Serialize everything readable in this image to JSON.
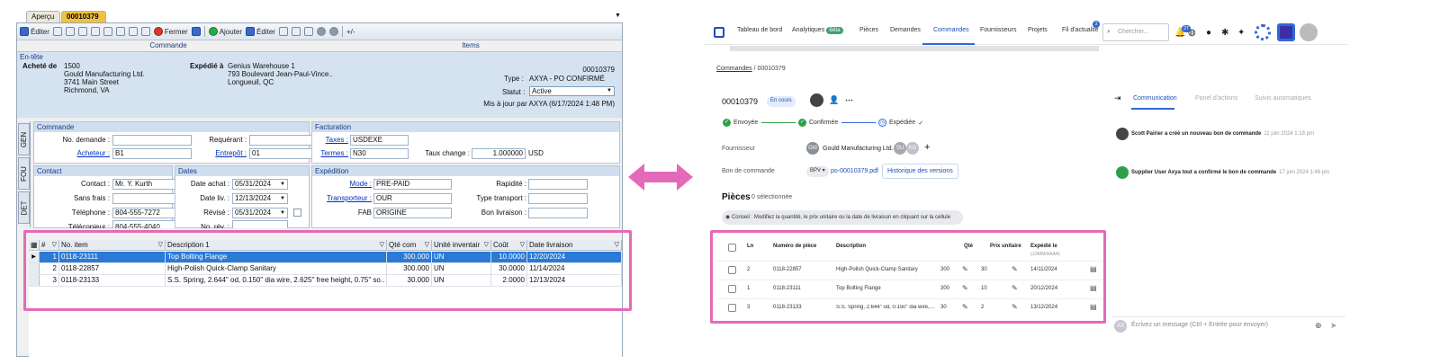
{
  "erp": {
    "tabs": [
      "Aperçu",
      "00010379"
    ],
    "toolbar": {
      "edit": "Éditer",
      "close": "Fermer",
      "add": "Ajouter",
      "edit2": "Éditer",
      "group_order": "Commande",
      "group_items": "Items"
    },
    "header": {
      "section": "En-tête",
      "bought_by_label": "Acheté de",
      "bought_by": [
        "1500",
        "Gould Manufacturing Ltd.",
        "3741 Main Street",
        "Richmond, VA"
      ],
      "shipped_to_label": "Expédié à",
      "shipped_to": [
        "Genius Warehouse 1",
        "793 Boulevard Jean-Paul-Vince..",
        "Longueuil, QC"
      ],
      "po_number": "00010379",
      "type_label": "Type :",
      "type": "AXYA - PO CONFIRMÉ",
      "status_label": "Statut :",
      "status": "Active",
      "updated": "Mis à jour par AXYA (6/17/2024 1:48 PM)"
    },
    "vtabs": [
      "GEN",
      "FOU",
      "DET"
    ],
    "commande": {
      "title": "Commande",
      "no_demande_label": "No. demande :",
      "no_demande": "",
      "requerant_label": "Requérant :",
      "requerant": "",
      "acheteur_label": "Acheteur :",
      "acheteur": "B1",
      "entrepot_label": "Entrepôt :",
      "entrepot": "01"
    },
    "facturation": {
      "title": "Facturation",
      "taxes_label": "Taxes :",
      "taxes": "USDEXE",
      "termes_label": "Termes :",
      "termes": "N30",
      "taux_label": "Taux change :",
      "taux": "1.000000",
      "currency": "USD"
    },
    "contact": {
      "title": "Contact",
      "contact_label": "Contact :",
      "contact": "Mr. Y. Kurth",
      "sans_frais_label": "Sans frais :",
      "sans_frais": "",
      "telephone_label": "Téléphone :",
      "telephone": "804-555-7272",
      "telecopieur_label": "Télécopieur :",
      "telecopieur": "804-555-4040"
    },
    "dates": {
      "title": "Dates",
      "achat_label": "Date achat :",
      "achat": "05/31/2024",
      "liv_label": "Date liv. :",
      "liv": "12/13/2024",
      "revise_label": "Révisé :",
      "revise": "05/31/2024",
      "no_rev_label": "No. rév. :",
      "no_rev": ""
    },
    "expedition": {
      "title": "Expédition",
      "mode_label": "Mode :",
      "mode": "PRE-PAID",
      "transporteur_label": "Transporteur :",
      "transporteur": "OUR",
      "fab_label": "FAB",
      "fab": "ORIGINE",
      "rapidite_label": "Rapidité :",
      "rapidite": "",
      "type_transport_label": "Type transport :",
      "type_transport": "",
      "bon_livraison_label": "Bon livraison :",
      "bon_livraison": ""
    },
    "grid": {
      "columns": [
        "#",
        "No. item",
        "Description 1",
        "Qté com",
        "Unité inventair",
        "Coût",
        "Date livraison"
      ],
      "rows": [
        [
          "1",
          "0118-23111",
          "Top Bolting Flange",
          "300.000",
          "UN",
          "10.0000",
          "12/20/2024"
        ],
        [
          "2",
          "0118-22857",
          "High-Polish Quick-Clamp Sanitary",
          "300.000",
          "UN",
          "30.0000",
          "11/14/2024"
        ],
        [
          "3",
          "0118-23133",
          "S.S. Spring, 2.644\" od, 0.150\" dia wire, 2.625\" free height, 0.75\" so..",
          "30.000",
          "UN",
          "2.0000",
          "12/13/2024"
        ]
      ]
    }
  },
  "web": {
    "nav": [
      "Tableau de bord",
      "Analytiques",
      "Pièces",
      "Demandes",
      "Commandes",
      "Fournisseurs",
      "Projets",
      "Fil d'actualité"
    ],
    "nav_badge": "Bêta",
    "feed_count": "3",
    "notif_count": "27",
    "search_placeholder": "Chercher...",
    "breadcrumb_root": "Commandes",
    "breadcrumb_sep": "/",
    "breadcrumb_current": "00010379",
    "po_number": "00010379",
    "po_status": "En cours",
    "steps": [
      "Envoyée",
      "Confirmée",
      "Expédiée"
    ],
    "supplier_label": "Fournisseur",
    "supplier_initials": "GM",
    "supplier_name": "Gould Manufacturing Ltd.",
    "supplier_avatars": [
      "SU",
      "KG"
    ],
    "po_doc_label": "Bon de commande",
    "po_doc_version": "BPV",
    "po_doc_file": "po-00010379.pdf",
    "version_history": "Historique des versions",
    "pieces_title": "Pièces",
    "pieces_sub": "0 sélectionnée",
    "tip": "Conseil : Modifiez la quantité, le prix unitaire ou la date de livraison en cliquant sur la cellule",
    "table": {
      "headers": [
        "Ln",
        "Numéro de pièce",
        "Description",
        "Qté",
        "Prix unitaire",
        "Expédié le"
      ],
      "date_hint": "(JJ/MM/AAAA)",
      "rows": [
        [
          "2",
          "0118-22857",
          "High-Polish Quick-Clamp Sanitary",
          "300",
          "30",
          "14/11/2024"
        ],
        [
          "1",
          "0118-23111",
          "Top Bolting Flange",
          "300",
          "10",
          "20/12/2024"
        ],
        [
          "3",
          "0118-23133",
          "S.S. Spring, 2.644\" od, 0.150\" dia wire,…",
          "30",
          "2",
          "13/12/2024"
        ]
      ]
    },
    "side_tabs": [
      "Communication",
      "Panel d'actions",
      "Suivis automatiques"
    ],
    "events": [
      {
        "text": "Scott Pairier a créé un nouveau bon de commande",
        "time": "11 juin 2024 1:18 pm"
      },
      {
        "text": "Supplier User Axya tout a confirmé le bon de commande",
        "time": "17 juin 2024 1:46 pm"
      }
    ],
    "message_avatar": "AX",
    "message_placeholder": "Écrivez un message (Ctrl + Entrée pour envoyer)"
  },
  "colors": {
    "highlight": "#e46ab9",
    "accent": "#3168d6",
    "erp_selected": "#2a7ad6"
  }
}
